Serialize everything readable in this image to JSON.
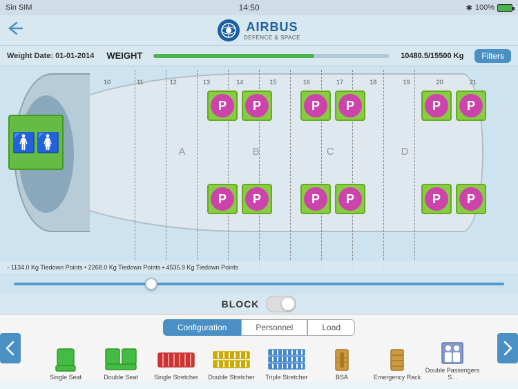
{
  "statusBar": {
    "carrier": "Sin SIM",
    "time": "14:50",
    "bluetooth": "✱",
    "battery": "100%"
  },
  "header": {
    "backLabel": "←",
    "logoTitle": "AIRBUS",
    "logoSubtitle": "DEFENCE & SPACE"
  },
  "weightBar": {
    "dateLabel": "Weight Date: 01-01-2014",
    "weightLabel": "WEIGHT",
    "weightValue": "10480.5/15500 Kg",
    "filterButton": "Filters",
    "progressPercent": 68
  },
  "tiedown": {
    "legend": "◦ 1134.0 Kg Tiedown Points  • 2268.0 Kg Tiedown Points  ▪ 4535.9 Kg Tiedown Points"
  },
  "block": {
    "label": "BLOCK"
  },
  "tabs": {
    "items": [
      "Configuration",
      "Personnel",
      "Load"
    ],
    "activeIndex": 0
  },
  "colNumbers": [
    "10",
    "11",
    "12",
    "13",
    "14",
    "15",
    "16",
    "17",
    "18",
    "19",
    "20",
    "21"
  ],
  "zones": [
    "A",
    "B",
    "C",
    "D"
  ],
  "equipment": [
    {
      "id": "single-seat",
      "label": "Single Seat"
    },
    {
      "id": "double-seat",
      "label": "Double Seat"
    },
    {
      "id": "single-stretcher",
      "label": "Single Stretcher"
    },
    {
      "id": "double-stretcher",
      "label": "Double Stretcher"
    },
    {
      "id": "triple-stretcher",
      "label": "Triple Stretcher"
    },
    {
      "id": "bsa",
      "label": "BSA"
    },
    {
      "id": "emergency-rack",
      "label": "Emergency Rack"
    },
    {
      "id": "double-passengers",
      "label": "Double Passengers S..."
    }
  ]
}
